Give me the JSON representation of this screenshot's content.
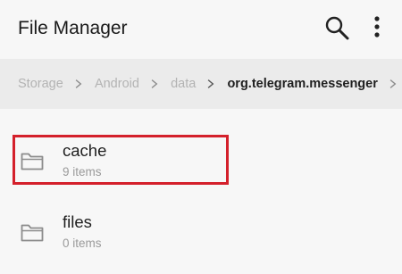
{
  "app_bar": {
    "title": "File Manager",
    "search_icon": "search-icon",
    "more_icon": "more-vert-icon"
  },
  "breadcrumb": {
    "items": [
      {
        "label": "Storage"
      },
      {
        "label": "Android"
      },
      {
        "label": "data"
      },
      {
        "label": "org.telegram.messenger",
        "current": true
      }
    ]
  },
  "folders": [
    {
      "name": "cache",
      "count": "9 items",
      "icon": "folder-icon",
      "highlighted": true
    },
    {
      "name": "files",
      "count": "0 items",
      "icon": "folder-icon"
    }
  ],
  "colors": {
    "highlight": "#d4202b",
    "breadcrumb_bg": "#ebebeb",
    "background": "#f7f7f7"
  }
}
